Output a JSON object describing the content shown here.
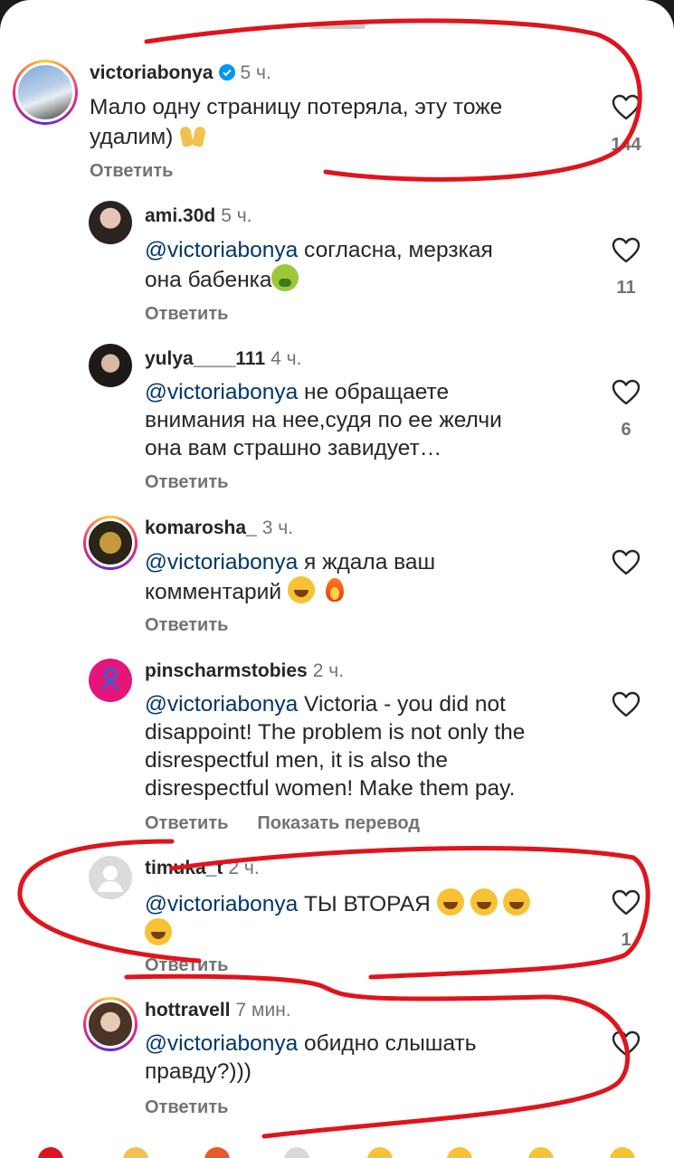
{
  "comments": [
    {
      "user": "victoriabonya",
      "time": "5 ч.",
      "verified": true,
      "text_line1": "Мало одну страницу потеряла, эту тоже",
      "text_line2": "удалим)",
      "reply": "Ответить",
      "likes": "144",
      "emoji": "raising-hands"
    },
    {
      "user": "ami.30d",
      "time": "5 ч.",
      "mention": "@victoriabonya",
      "text_line1": "согласна, мерзкая",
      "text_line2": "она бабенка",
      "reply": "Ответить",
      "likes": "11",
      "emoji": "nauseated-face"
    },
    {
      "user": "yulya____111",
      "time": "4 ч.",
      "mention": "@victoriabonya",
      "text_line1": "не обращаете",
      "text_line2": "внимания на нее,судя по ее желчи",
      "text_line3": "она вам страшно завидует…",
      "reply": "Ответить",
      "likes": "6"
    },
    {
      "user": "komarosha_",
      "time": "3 ч.",
      "mention": "@victoriabonya",
      "text_line1": "я ждала ваш",
      "text_line2": "комментарий",
      "reply": "Ответить",
      "emoji": [
        "tears-of-joy",
        "fire"
      ]
    },
    {
      "user": "pinscharmstobies",
      "time": "2 ч.",
      "mention": "@victoriabonya",
      "text_line1": "Victoria - you did not",
      "text_line2": "disappoint! The problem is not only the",
      "text_line3": "disrespectful men, it is also the",
      "text_line4": "disrespectful women! Make them pay.",
      "reply": "Ответить",
      "translate": "Показать перевод"
    },
    {
      "user": "timuka_t",
      "time": "2 ч.",
      "mention": "@victoriabonya",
      "text_line1": "ТЫ ВТОРАЯ",
      "reply": "Ответить",
      "likes": "1",
      "emoji": [
        "tears-of-joy",
        "tears-of-joy",
        "tears-of-joy",
        "tears-of-joy"
      ]
    },
    {
      "user": "hottravell",
      "time": "7 мин.",
      "mention": "@victoriabonya",
      "text_line1": "обидно слышать",
      "text_line2": "правду?)))",
      "reply": "Ответить"
    }
  ],
  "icons": {
    "like": "heart-outline-icon",
    "verified": "verified-badge-icon"
  },
  "colors": {
    "mention": "#00376b",
    "annotation": "#e0141c",
    "verified": "#0095f6"
  }
}
